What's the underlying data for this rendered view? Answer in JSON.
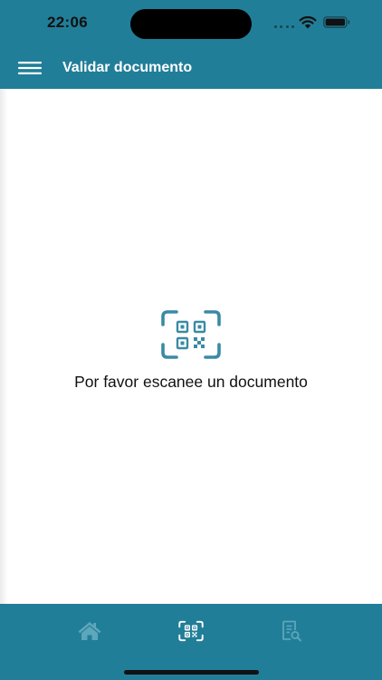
{
  "status_bar": {
    "time": "22:06"
  },
  "app_bar": {
    "title": "Validar documento",
    "menu_icon": "hamburger-menu-icon"
  },
  "main": {
    "scan_icon": "qr-scan-icon",
    "message": "Por favor escanee un documento"
  },
  "tab_bar": {
    "tabs": [
      {
        "icon": "home-icon",
        "active": false
      },
      {
        "icon": "qr-scan-icon",
        "active": true
      },
      {
        "icon": "document-search-icon",
        "active": false
      }
    ]
  },
  "colors": {
    "brand": "#217e98",
    "accent_icon": "#3a8aa5",
    "tab_active": "#ffffff",
    "tab_inactive": "#5ea6bb"
  }
}
